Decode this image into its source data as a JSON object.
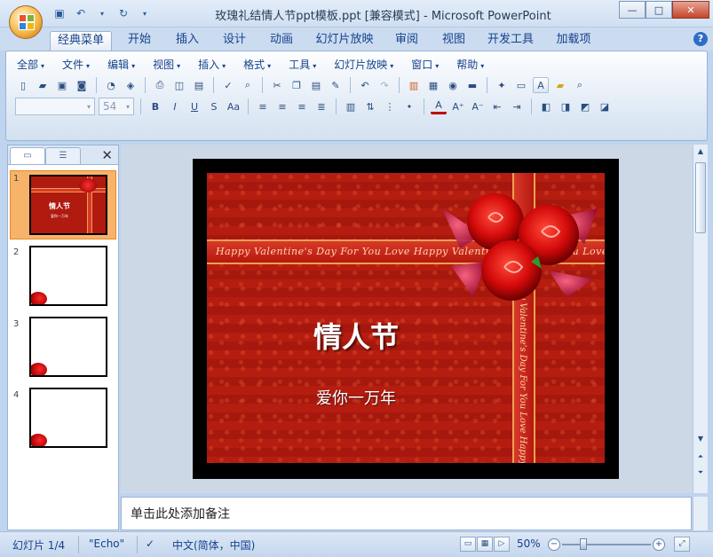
{
  "window": {
    "title": "玫瑰礼结情人节ppt模板.ppt [兼容模式] - Microsoft PowerPoint"
  },
  "ribbon_tabs": [
    "经典菜单",
    "开始",
    "插入",
    "设计",
    "动画",
    "幻灯片放映",
    "审阅",
    "视图",
    "开发工具",
    "加载项"
  ],
  "active_tab": "经典菜单",
  "classic_menu": [
    "全部",
    "文件",
    "编辑",
    "视图",
    "插入",
    "格式",
    "工具",
    "幻灯片放映",
    "窗口",
    "帮助"
  ],
  "toolbar": {
    "font_size_value": "54"
  },
  "slides_panel": {
    "thumb1_title": "情人节",
    "thumb1_subtitle": "爱你一万年",
    "numbers": [
      "1",
      "2",
      "3",
      "4"
    ]
  },
  "slide": {
    "title": "情人节",
    "subtitle": "爱你一万年",
    "ribbon_text": "Happy Valentine's Day For You Love Happy Valentine's Day For You Love",
    "vertical_ribbon_text": "Happy Valentine's Day For You Love Happy"
  },
  "notes": {
    "placeholder": "单击此处添加备注"
  },
  "statusbar": {
    "slide_info": "幻灯片 1/4",
    "theme": "\"Echo\"",
    "language": "中文(简体，中国)",
    "zoom": "50%"
  },
  "colors": {
    "slide_red": "#b01a0f",
    "ribbon_gold": "#f0a050",
    "selected_thumb": "#f8b36a"
  }
}
